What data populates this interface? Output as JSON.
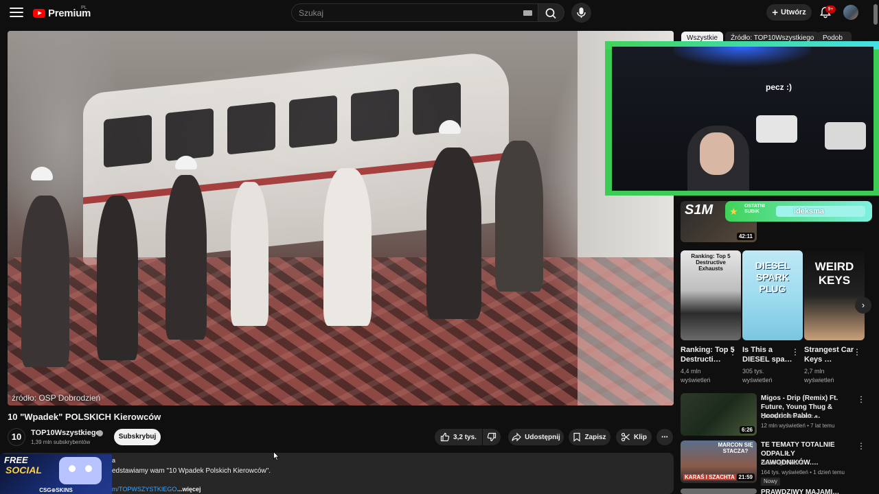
{
  "header": {
    "logo_text": "Premium",
    "logo_country": "PL",
    "search_placeholder": "Szukaj",
    "create_label": "Utwórz",
    "notif_badge": "9+"
  },
  "player": {
    "source_caption": "źródło: OSP Dobrodzień"
  },
  "overlay": {
    "cam_text": "pecz :)",
    "sub_label_line1": "OSTATNI",
    "sub_label_line2": "SUBIK",
    "sub_name": "ideksma"
  },
  "chips": [
    "Wszystkie",
    "Źródło: TOP10Wszystkiego",
    "Podob"
  ],
  "video": {
    "title": "10 \"Wpadek\" POLSKICH Kierowców",
    "channel_avatar_text": "10",
    "channel_name": "TOP10Wszystkiego",
    "subscribers": "1,39 mln subskrybentów",
    "subscribe_label": "Subskrybuj",
    "likes": "3,2 tys.",
    "share_label": "Udostępnij",
    "save_label": "Zapisz",
    "clip_label": "Klip",
    "more_label": "⋯"
  },
  "description": {
    "mark": "a",
    "text": "edstawiamy wam \"10 Wpadek Polskich Kierowców\".",
    "link": "m/TOPWSZYSTKIEGO",
    "more": "...więcej"
  },
  "ad": {
    "line1": "FREE",
    "line2": "SOCIAL",
    "brand": "CSG⊕SKINS"
  },
  "shelf": [
    {
      "title": "Ranking: Top 5 Destructi…",
      "views": "4,4 mln",
      "views_label": "wyświetleń",
      "thumb_text": "Ranking: Top 5 Destructive Exhausts"
    },
    {
      "title": "Is This a DIESEL spa…",
      "views": "305 tys.",
      "views_label": "wyświetleń",
      "thumb_text": "DIESEL SPARK PLUG"
    },
    {
      "title": "Strangest Car Keys …",
      "views": "2,7 mln",
      "views_label": "wyświetleń",
      "thumb_text": "WEIRD KEYS"
    }
  ],
  "first_rec": {
    "thumb_text": "S1M",
    "duration": "42:11"
  },
  "recs": [
    {
      "title": "Migos - Drip (Remix) Ft. Future, Young Thug & Hoodrich Pablo …",
      "channel": "Quality Control Music",
      "meta": "12 mln wyświetleń • 7 lat temu",
      "duration": "6:26"
    },
    {
      "title": "TE TEMATY TOTALNIE ODPALIŁY ZAWODNIKÓW.…",
      "channel": "FreakFightPolska",
      "meta": "164 tys. wyświetleń • 1 dzień temu",
      "duration": "21:59",
      "badge": "Nowy",
      "thumb_text_top": "MARCON SIĘ STACZA?",
      "thumb_text_bottom": "KARAŚ I SZACHTA"
    },
    {
      "title": "PRAWDZIWY MAJAMI…"
    }
  ],
  "colors": {
    "accent_red": "#ff0000",
    "overlay_green": "#3fd35a",
    "overlay_cyan": "#44e0e5",
    "link_blue": "#3ea6ff"
  }
}
